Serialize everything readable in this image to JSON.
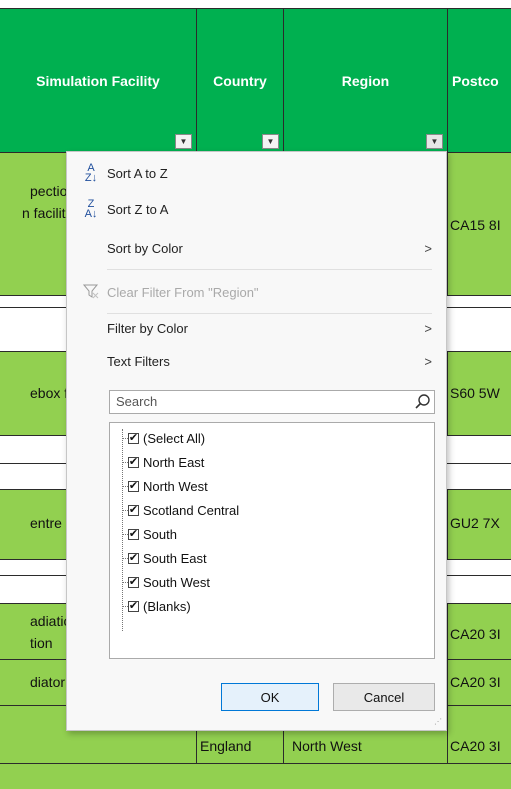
{
  "headers": {
    "facility": "Simulation Facility",
    "country": "Country",
    "region": "Region",
    "postcode": "Postco"
  },
  "cells": {
    "r1_facility_line1": "pection",
    "r1_facility_line2": "n facilit",
    "r1_postcode": "CA15 8I",
    "r2_facility": "ebox fa",
    "r2_postcode": "S60 5W",
    "r3_facility": "entre",
    "r3_postcode": "GU2 7X",
    "r4_facility_line1": "adiatio",
    "r4_facility_line2": "tion",
    "r4_postcode": "CA20 3I",
    "r5_facility": "diator",
    "r5_postcode": "CA20 3I",
    "r6_country": "England",
    "r6_region": "North West",
    "r6_postcode": "CA20 3I"
  },
  "menu": {
    "sort_az": "Sort A to Z",
    "sort_za": "Sort Z to A",
    "sort_color": "Sort by Color",
    "clear_filter": "Clear Filter From \"Region\"",
    "filter_color": "Filter by Color",
    "text_filters": "Text Filters",
    "search_placeholder": "Search",
    "items": [
      {
        "label": "(Select All)",
        "checked": true
      },
      {
        "label": "North East",
        "checked": true
      },
      {
        "label": "North West",
        "checked": true
      },
      {
        "label": "Scotland Central",
        "checked": true
      },
      {
        "label": "South",
        "checked": true
      },
      {
        "label": "South East",
        "checked": true
      },
      {
        "label": "South West",
        "checked": true
      },
      {
        "label": "(Blanks)",
        "checked": true
      }
    ],
    "ok": "OK",
    "cancel": "Cancel"
  },
  "icons": {
    "sort_az": "sort-ascending-icon",
    "sort_za": "sort-descending-icon",
    "clear_filter": "clear-filter-icon",
    "search": "search-icon",
    "dropdown": "filter-dropdown-icon"
  },
  "colors": {
    "header_green": "#00b050",
    "row_green": "#92d050"
  }
}
